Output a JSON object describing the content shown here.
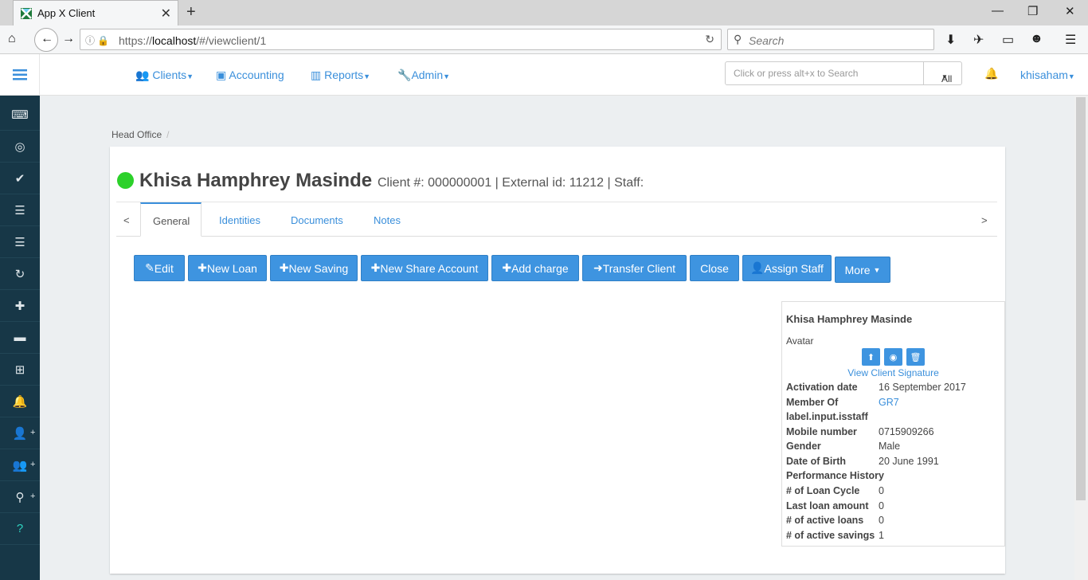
{
  "browser": {
    "tab_title": "App X Client",
    "url_prefix": "https://",
    "url_host": "localhost",
    "url_path": "/#/viewclient/1",
    "search_placeholder": "Search"
  },
  "header": {
    "menus": [
      "Clients",
      "Accounting",
      "Reports",
      "Admin"
    ],
    "search_placeholder": "Click or press alt+x to Search",
    "search_scope": "All",
    "user": "khisaham"
  },
  "breadcrumb": {
    "office": "Head Office",
    "separator": "/"
  },
  "client": {
    "name": "Khisa Hamphrey Masinde",
    "meta": "Client #: 000000001 | External id: 11212 | Staff:",
    "status_color": "#2cd12a"
  },
  "tabs": {
    "prev": "<",
    "next": ">",
    "items": [
      "General",
      "Identities",
      "Documents",
      "Notes"
    ]
  },
  "actions": {
    "edit": "Edit",
    "new_loan": "New Loan",
    "new_saving": "New Saving",
    "new_share": "New Share Account",
    "add_charge": "Add charge",
    "transfer": "Transfer Client",
    "close": "Close",
    "assign_staff": "Assign Staff",
    "more": "More"
  },
  "panel": {
    "name": "Khisa Hamphrey Masinde",
    "avatar_label": "Avatar",
    "signature_link": "View Client Signature",
    "rows": [
      {
        "k": "Activation date",
        "v": "16 September 2017"
      },
      {
        "k": "Member Of",
        "v": "GR7"
      },
      {
        "k": "label.input.isstaff",
        "v": ""
      },
      {
        "k": "Mobile number",
        "v": "0715909266"
      },
      {
        "k": "Gender",
        "v": "Male"
      },
      {
        "k": "Date of Birth",
        "v": "20 June 1991"
      },
      {
        "k": "Performance History",
        "v": ""
      },
      {
        "k": "# of Loan Cycle",
        "v": "0"
      },
      {
        "k": "Last loan amount",
        "v": "0"
      },
      {
        "k": "# of active loans",
        "v": "0"
      },
      {
        "k": "# of active savings",
        "v": "1"
      }
    ]
  },
  "colors": {
    "accent": "#3e94e0",
    "sidebar": "#173747"
  }
}
